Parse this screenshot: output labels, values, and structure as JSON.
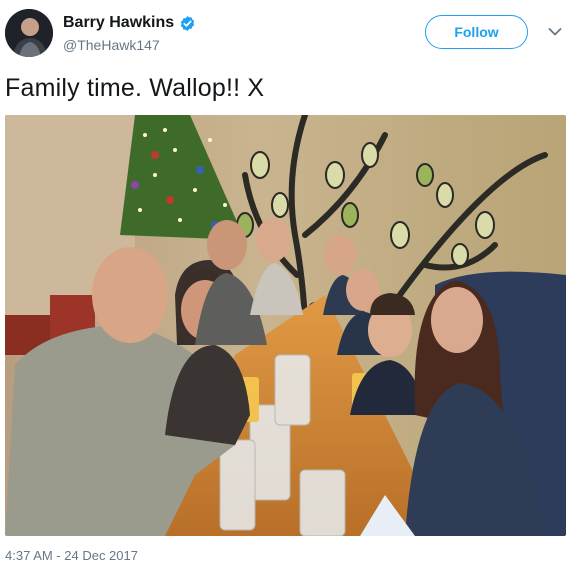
{
  "author": {
    "name": "Barry Hawkins",
    "handle": "@TheHawk147",
    "verified": true,
    "avatar_icon": "profile-photo"
  },
  "follow_button": {
    "label": "Follow"
  },
  "menu_icon": "chevron-down-icon",
  "tweet": {
    "text": "Family time. Wallop!! X",
    "timestamp": "4:37 AM - 24 Dec 2017"
  },
  "colors": {
    "accent": "#1da1f2",
    "name": "#14171a",
    "muted": "#657786"
  }
}
